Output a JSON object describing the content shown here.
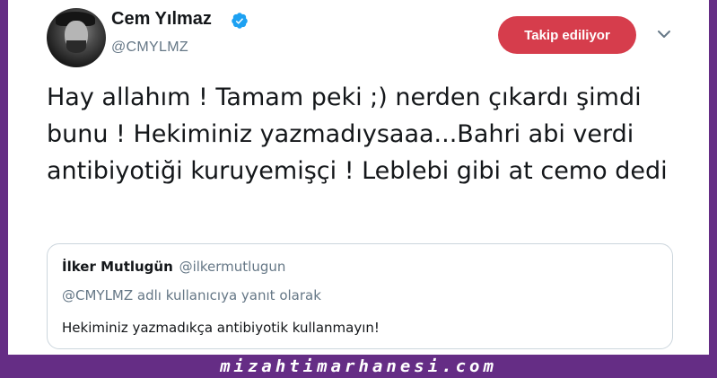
{
  "tweet": {
    "author": {
      "display_name": "Cem Yılmaz",
      "handle": "@CMYLMZ",
      "verified": true,
      "avatar": "profile-photo"
    },
    "follow_button_label": "Takip ediliyor",
    "menu_icon": "chevron-down-icon",
    "text": "Hay allahım ! Tamam peki ;) nerden çıkardı şimdi bunu ! Hekiminiz yazmadıysaaa...Bahri abi verdi antibiyotiği kuruyemişçi ! Leblebi gibi at cemo dedi",
    "quoted_tweet": {
      "display_name": "İlker Mutlugün",
      "handle": "@ilkermutlugun",
      "reply_context": "@CMYLMZ adlı kullanıcıya yanıt olarak",
      "text": "Hekiminiz yazmadıkça antibiyotik kullanmayın!"
    }
  },
  "watermark": "mizahtimarhanesi.com",
  "colors": {
    "frame": "#652d85",
    "follow_button": "#d63d4c",
    "verified_badge": "#1da1f2",
    "secondary_text": "#657786"
  }
}
